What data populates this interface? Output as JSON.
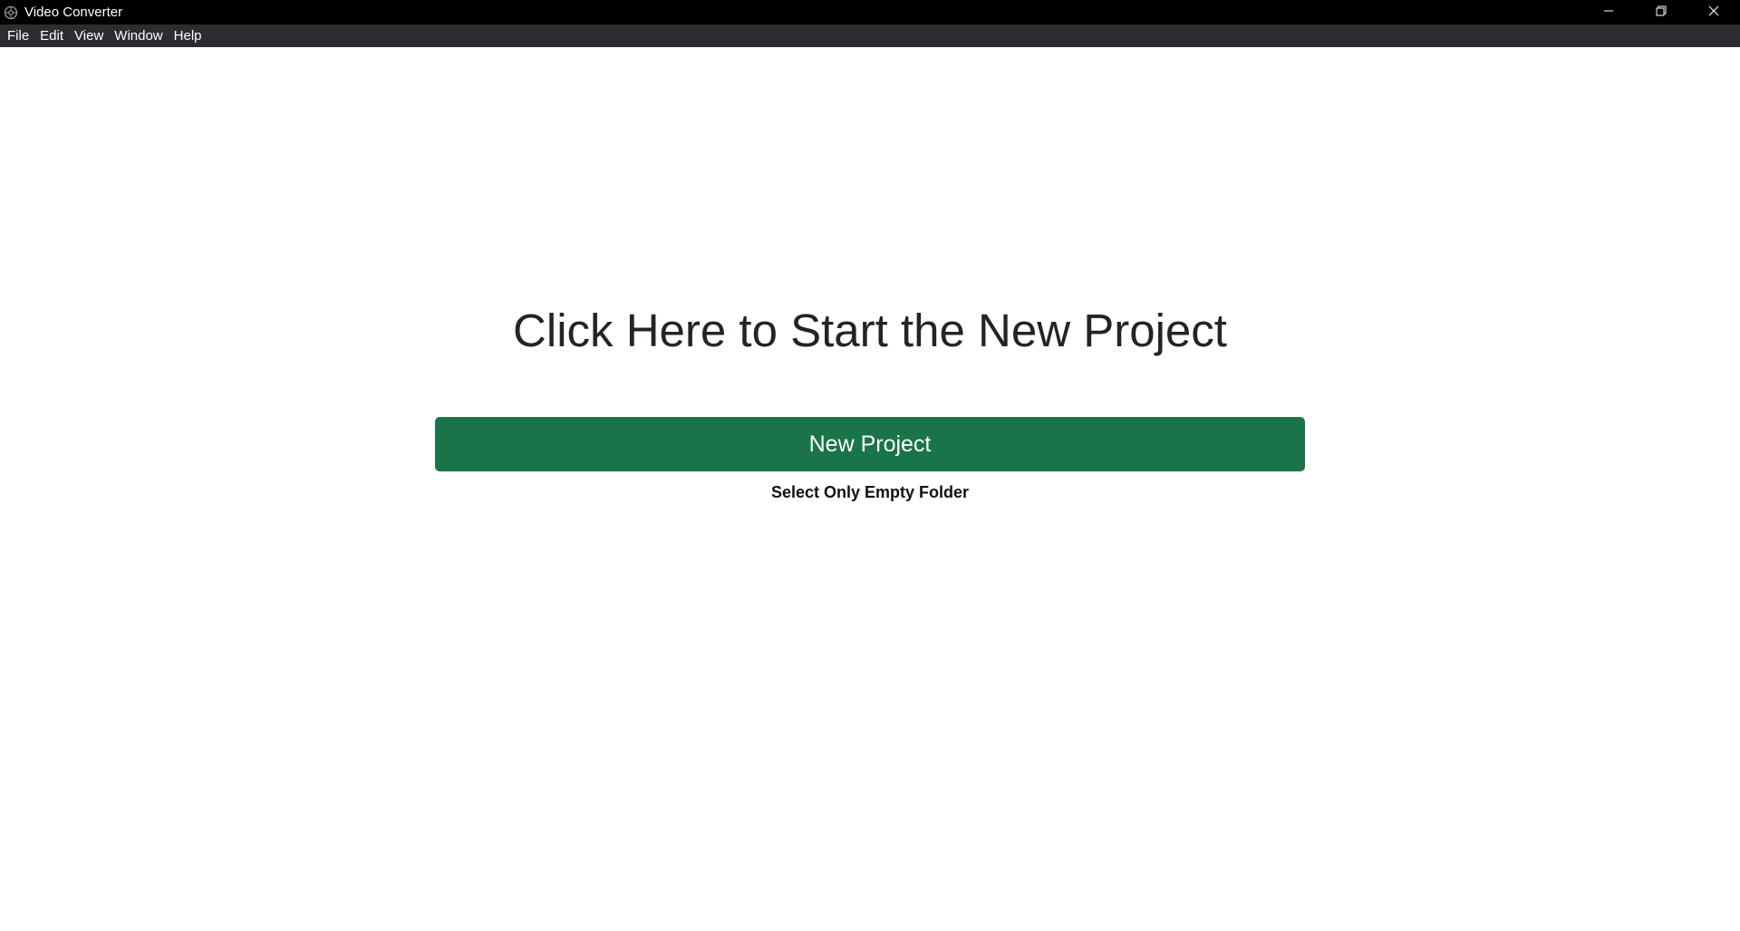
{
  "window": {
    "title": "Video Converter",
    "controls": {
      "minimize_icon": "minimize-icon",
      "restore_icon": "restore-icon",
      "close_icon": "close-icon"
    }
  },
  "menubar": {
    "items": [
      {
        "label": "File"
      },
      {
        "label": "Edit"
      },
      {
        "label": "View"
      },
      {
        "label": "Window"
      },
      {
        "label": "Help"
      }
    ]
  },
  "main": {
    "heading": "Click Here to Start the New Project",
    "new_project_button": "New Project",
    "hint": "Select Only Empty Folder"
  },
  "colors": {
    "titlebar_bg": "#000000",
    "menubar_bg": "#2b2d31",
    "button_bg": "#1a744a",
    "heading_text": "#212529"
  }
}
